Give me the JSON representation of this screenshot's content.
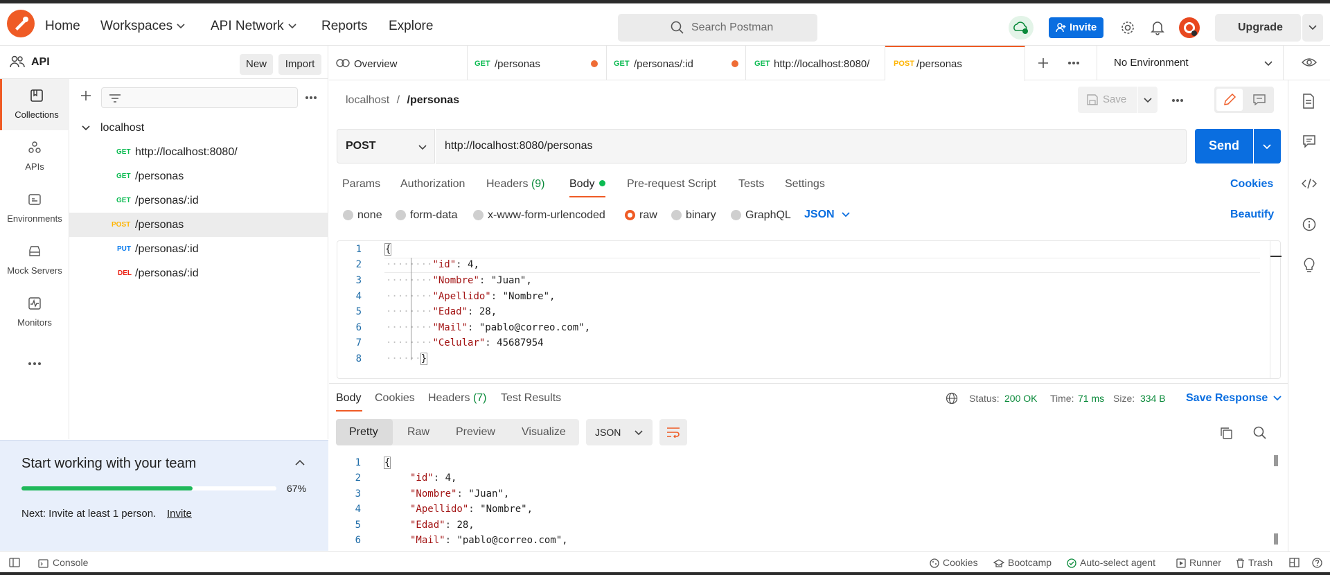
{
  "header": {
    "nav": [
      "Home",
      "Workspaces",
      "API Network",
      "Reports",
      "Explore"
    ],
    "search_placeholder": "Search Postman",
    "invite_label": "Invite",
    "upgrade_label": "Upgrade"
  },
  "sidebar": {
    "workspace_name": "API",
    "new_label": "New",
    "import_label": "Import",
    "rail": [
      "Collections",
      "APIs",
      "Environments",
      "Mock Servers",
      "Monitors"
    ],
    "collection_name": "localhost",
    "items": [
      {
        "method": "GET",
        "name": "http://localhost:8080/"
      },
      {
        "method": "GET",
        "name": "/personas"
      },
      {
        "method": "GET",
        "name": "/personas/:id"
      },
      {
        "method": "POST",
        "name": "/personas"
      },
      {
        "method": "PUT",
        "name": "/personas/:id"
      },
      {
        "method": "DEL",
        "name": "/personas/:id"
      }
    ],
    "team_card": {
      "title": "Start working with your team",
      "progress_pct": "67%",
      "progress_value": 0.67,
      "next_text": "Next: Invite at least 1 person.",
      "next_link": "Invite"
    }
  },
  "tabs": {
    "items": [
      {
        "method": "",
        "name": "Overview"
      },
      {
        "method": "GET",
        "name": "/personas"
      },
      {
        "method": "GET",
        "name": "/personas/:id"
      },
      {
        "method": "GET",
        "name": "http://localhost:8080/"
      },
      {
        "method": "POST",
        "name": "/personas"
      }
    ],
    "environment": "No Environment"
  },
  "request": {
    "breadcrumb_parent": "localhost",
    "breadcrumb_sep": "/",
    "breadcrumb_current": "/personas",
    "save_label": "Save",
    "method": "POST",
    "url": "http://localhost:8080/personas",
    "send_label": "Send",
    "subtabs": [
      "Params",
      "Authorization",
      "Headers",
      "Body",
      "Pre-request Script",
      "Tests",
      "Settings"
    ],
    "headers_count": "(9)",
    "cookies_label": "Cookies",
    "body_types": [
      "none",
      "form-data",
      "x-www-form-urlencoded",
      "raw",
      "binary",
      "GraphQL"
    ],
    "body_format": "JSON",
    "beautify_label": "Beautify",
    "body_lines": [
      "{",
      "\"id\": 4,",
      "\"Nombre\": \"Juan\",",
      "\"Apellido\": \"Nombre\",",
      "\"Edad\": 28,",
      "\"Mail\": \"pablo@correo.com\",",
      "\"Celular\": 45687954",
      "}"
    ]
  },
  "response": {
    "tabs": [
      "Body",
      "Cookies",
      "Headers",
      "Test Results"
    ],
    "headers_count": "(7)",
    "status_label": "Status:",
    "status_value": "200 OK",
    "time_label": "Time:",
    "time_value": "71 ms",
    "size_label": "Size:",
    "size_value": "334 B",
    "save_response": "Save Response",
    "view_modes": [
      "Pretty",
      "Raw",
      "Preview",
      "Visualize"
    ],
    "format": "JSON"
  },
  "statusbar": {
    "console": "Console",
    "items": [
      "Cookies",
      "Bootcamp",
      "Auto-select agent",
      "Runner",
      "Trash"
    ]
  },
  "colors": {
    "accent_orange": "#ef5b25",
    "blue": "#0a6ee0",
    "get": "#0cbb52",
    "post": "#ffb400",
    "put": "#097bed",
    "del": "#eb2013",
    "status_ok": "#0a8a3a"
  }
}
